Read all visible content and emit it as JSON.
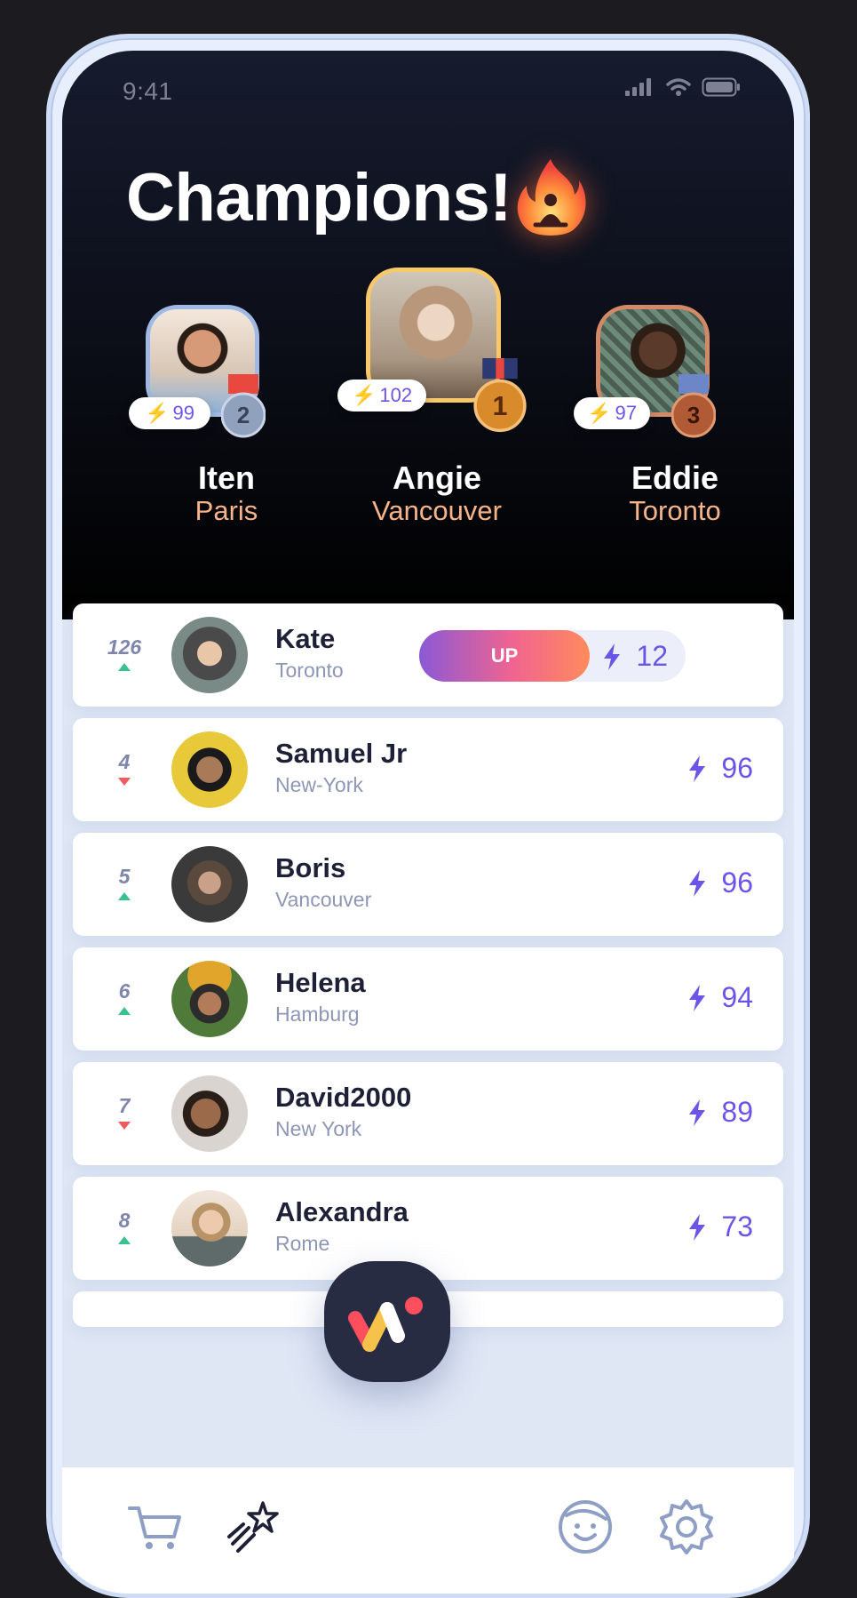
{
  "status": {
    "time": "9:41"
  },
  "header": {
    "title": "Champions!",
    "icon": "fire-meditation-icon"
  },
  "podium": [
    {
      "place": "2",
      "name": "Iten",
      "city": "Paris",
      "points": "99",
      "frame_color": "#9fb9e4",
      "medal_color": "#8fa1bd"
    },
    {
      "place": "1",
      "name": "Angie",
      "city": "Vancouver",
      "points": "102",
      "frame_color": "#f7c96a",
      "medal_color": "#d98b2c"
    },
    {
      "place": "3",
      "name": "Eddie",
      "city": "Toronto",
      "points": "97",
      "frame_color": "#d28a66",
      "medal_color": "#b05a36"
    }
  ],
  "leaderboard": {
    "current_user": {
      "rank": "126",
      "trend": "up",
      "name": "Kate",
      "city": "Toronto",
      "action": "UP",
      "points": "12"
    },
    "rows": [
      {
        "rank": "4",
        "trend": "down",
        "name": "Samuel Jr",
        "city": "New-York",
        "points": "96"
      },
      {
        "rank": "5",
        "trend": "up",
        "name": "Boris",
        "city": "Vancouver",
        "points": "96"
      },
      {
        "rank": "6",
        "trend": "up",
        "name": "Helena",
        "city": "Hamburg",
        "points": "94"
      },
      {
        "rank": "7",
        "trend": "down",
        "name": "David2000",
        "city": "New York",
        "points": "89"
      },
      {
        "rank": "8",
        "trend": "up",
        "name": "Alexandra",
        "city": "Rome",
        "points": "73"
      }
    ]
  },
  "tabbar": {
    "items": [
      "cart-icon",
      "shooting-star-icon",
      "app-logo-icon",
      "chat-face-icon",
      "settings-gear-icon"
    ],
    "active": "shooting-star-icon"
  },
  "colors": {
    "accent": "#6a55e8",
    "trend_up": "#39c18e",
    "trend_down": "#f05b5b",
    "city": "#f7b48a"
  }
}
